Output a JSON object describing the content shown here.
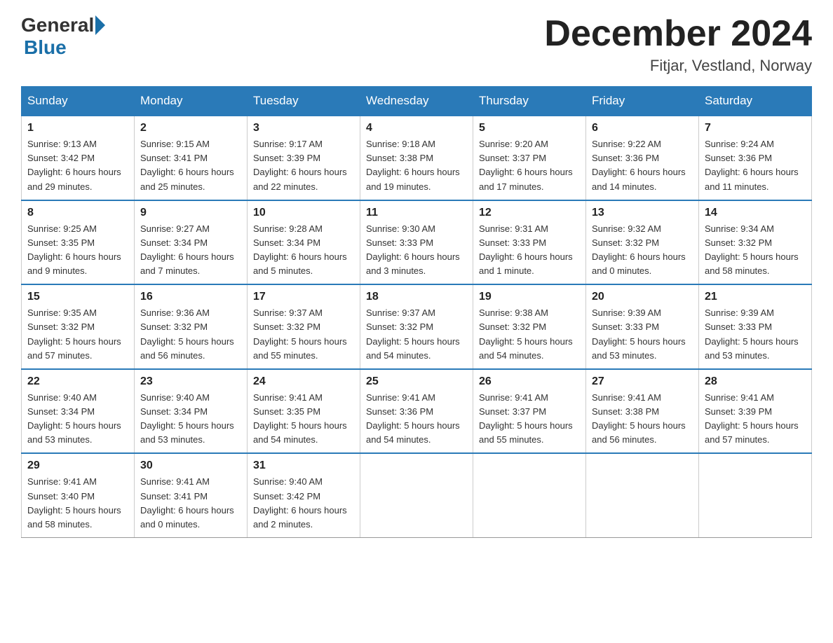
{
  "header": {
    "logo": {
      "general": "General",
      "blue": "Blue"
    },
    "title": "December 2024",
    "location": "Fitjar, Vestland, Norway"
  },
  "days_of_week": [
    "Sunday",
    "Monday",
    "Tuesday",
    "Wednesday",
    "Thursday",
    "Friday",
    "Saturday"
  ],
  "weeks": [
    [
      {
        "day": "1",
        "sunrise": "9:13 AM",
        "sunset": "3:42 PM",
        "daylight": "6 hours and 29 minutes."
      },
      {
        "day": "2",
        "sunrise": "9:15 AM",
        "sunset": "3:41 PM",
        "daylight": "6 hours and 25 minutes."
      },
      {
        "day": "3",
        "sunrise": "9:17 AM",
        "sunset": "3:39 PM",
        "daylight": "6 hours and 22 minutes."
      },
      {
        "day": "4",
        "sunrise": "9:18 AM",
        "sunset": "3:38 PM",
        "daylight": "6 hours and 19 minutes."
      },
      {
        "day": "5",
        "sunrise": "9:20 AM",
        "sunset": "3:37 PM",
        "daylight": "6 hours and 17 minutes."
      },
      {
        "day": "6",
        "sunrise": "9:22 AM",
        "sunset": "3:36 PM",
        "daylight": "6 hours and 14 minutes."
      },
      {
        "day": "7",
        "sunrise": "9:24 AM",
        "sunset": "3:36 PM",
        "daylight": "6 hours and 11 minutes."
      }
    ],
    [
      {
        "day": "8",
        "sunrise": "9:25 AM",
        "sunset": "3:35 PM",
        "daylight": "6 hours and 9 minutes."
      },
      {
        "day": "9",
        "sunrise": "9:27 AM",
        "sunset": "3:34 PM",
        "daylight": "6 hours and 7 minutes."
      },
      {
        "day": "10",
        "sunrise": "9:28 AM",
        "sunset": "3:34 PM",
        "daylight": "6 hours and 5 minutes."
      },
      {
        "day": "11",
        "sunrise": "9:30 AM",
        "sunset": "3:33 PM",
        "daylight": "6 hours and 3 minutes."
      },
      {
        "day": "12",
        "sunrise": "9:31 AM",
        "sunset": "3:33 PM",
        "daylight": "6 hours and 1 minute."
      },
      {
        "day": "13",
        "sunrise": "9:32 AM",
        "sunset": "3:32 PM",
        "daylight": "6 hours and 0 minutes."
      },
      {
        "day": "14",
        "sunrise": "9:34 AM",
        "sunset": "3:32 PM",
        "daylight": "5 hours and 58 minutes."
      }
    ],
    [
      {
        "day": "15",
        "sunrise": "9:35 AM",
        "sunset": "3:32 PM",
        "daylight": "5 hours and 57 minutes."
      },
      {
        "day": "16",
        "sunrise": "9:36 AM",
        "sunset": "3:32 PM",
        "daylight": "5 hours and 56 minutes."
      },
      {
        "day": "17",
        "sunrise": "9:37 AM",
        "sunset": "3:32 PM",
        "daylight": "5 hours and 55 minutes."
      },
      {
        "day": "18",
        "sunrise": "9:37 AM",
        "sunset": "3:32 PM",
        "daylight": "5 hours and 54 minutes."
      },
      {
        "day": "19",
        "sunrise": "9:38 AM",
        "sunset": "3:32 PM",
        "daylight": "5 hours and 54 minutes."
      },
      {
        "day": "20",
        "sunrise": "9:39 AM",
        "sunset": "3:33 PM",
        "daylight": "5 hours and 53 minutes."
      },
      {
        "day": "21",
        "sunrise": "9:39 AM",
        "sunset": "3:33 PM",
        "daylight": "5 hours and 53 minutes."
      }
    ],
    [
      {
        "day": "22",
        "sunrise": "9:40 AM",
        "sunset": "3:34 PM",
        "daylight": "5 hours and 53 minutes."
      },
      {
        "day": "23",
        "sunrise": "9:40 AM",
        "sunset": "3:34 PM",
        "daylight": "5 hours and 53 minutes."
      },
      {
        "day": "24",
        "sunrise": "9:41 AM",
        "sunset": "3:35 PM",
        "daylight": "5 hours and 54 minutes."
      },
      {
        "day": "25",
        "sunrise": "9:41 AM",
        "sunset": "3:36 PM",
        "daylight": "5 hours and 54 minutes."
      },
      {
        "day": "26",
        "sunrise": "9:41 AM",
        "sunset": "3:37 PM",
        "daylight": "5 hours and 55 minutes."
      },
      {
        "day": "27",
        "sunrise": "9:41 AM",
        "sunset": "3:38 PM",
        "daylight": "5 hours and 56 minutes."
      },
      {
        "day": "28",
        "sunrise": "9:41 AM",
        "sunset": "3:39 PM",
        "daylight": "5 hours and 57 minutes."
      }
    ],
    [
      {
        "day": "29",
        "sunrise": "9:41 AM",
        "sunset": "3:40 PM",
        "daylight": "5 hours and 58 minutes."
      },
      {
        "day": "30",
        "sunrise": "9:41 AM",
        "sunset": "3:41 PM",
        "daylight": "6 hours and 0 minutes."
      },
      {
        "day": "31",
        "sunrise": "9:40 AM",
        "sunset": "3:42 PM",
        "daylight": "6 hours and 2 minutes."
      },
      null,
      null,
      null,
      null
    ]
  ],
  "labels": {
    "sunrise": "Sunrise:",
    "sunset": "Sunset:",
    "daylight": "Daylight:"
  }
}
